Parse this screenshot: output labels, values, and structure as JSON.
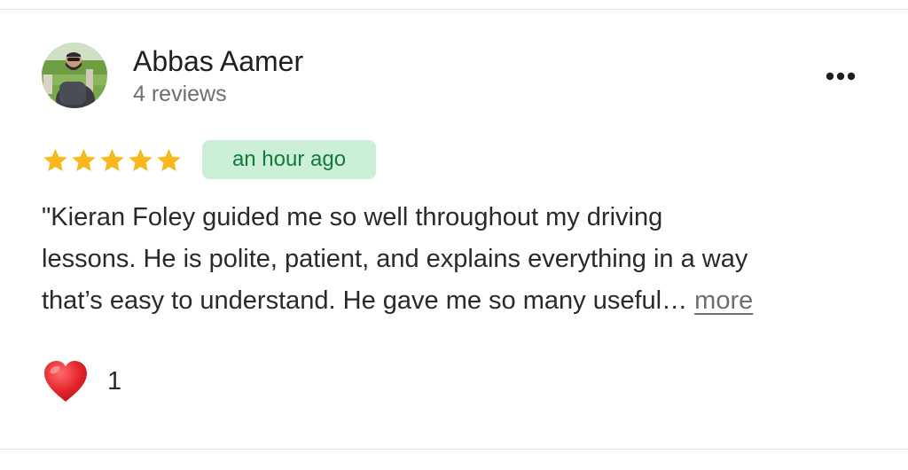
{
  "review": {
    "author": {
      "name": "Abbas Aamer",
      "reviews_label": "4 reviews",
      "avatar_icon": "profile-photo"
    },
    "more_options_icon": "three-dots-horizontal-icon",
    "rating": {
      "stars": 5,
      "max": 5,
      "color": "#f8b81d"
    },
    "time_label": "an hour ago",
    "time_badge_colors": {
      "background": "#ccefd8",
      "text": "#137a3a"
    },
    "text_lines": [
      "\"Kieran Foley guided me so well throughout my driving",
      "lessons. He is polite, patient, and explains everything in a way",
      "that’s easy to understand. He gave me so many useful…"
    ],
    "more_label": "more",
    "reaction": {
      "icon": "heart-icon",
      "count": "1",
      "color": "#d9252a"
    }
  }
}
